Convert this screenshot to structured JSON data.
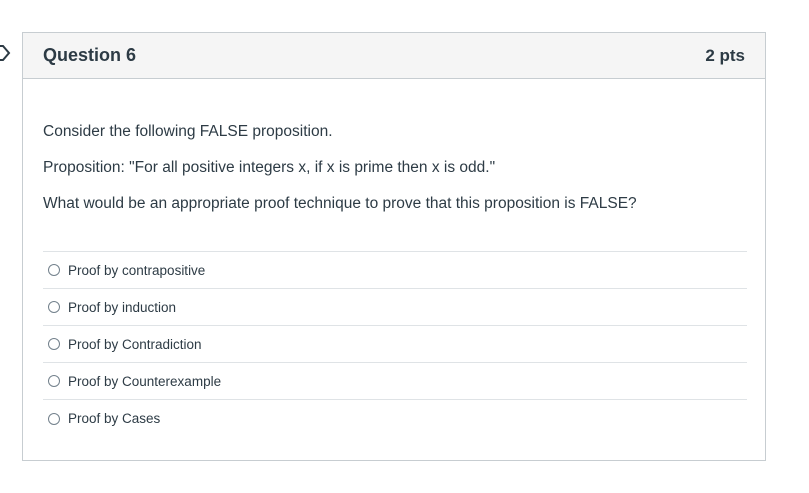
{
  "question": {
    "title": "Question 6",
    "points": "2 pts",
    "prompt_lines": [
      "Consider the following FALSE proposition.",
      "Proposition: \"For all positive integers x, if x is prime then x is odd.\"",
      "What would be an appropriate proof technique to prove that this proposition is FALSE?"
    ],
    "answers": [
      {
        "label": "Proof by contrapositive"
      },
      {
        "label": "Proof by induction"
      },
      {
        "label": "Proof by Contradiction"
      },
      {
        "label": "Proof by Counterexample"
      },
      {
        "label": "Proof by Cases"
      }
    ]
  },
  "colors": {
    "text": "#2d3b45",
    "header_bg": "#f5f5f5",
    "border": "#c7cdd1",
    "flag": "#2d3b45"
  },
  "icons": {
    "flag": "flag-outline-icon",
    "radio": "radio-unselected-icon"
  }
}
